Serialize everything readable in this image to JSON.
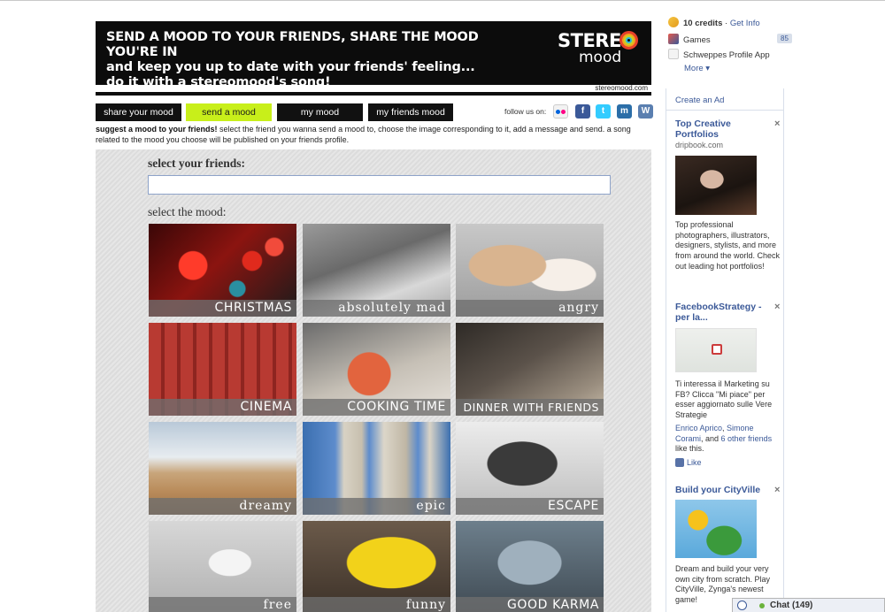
{
  "banner": {
    "line1": "SEND A MOOD TO YOUR FRIENDS, SHARE THE MOOD YOU'RE IN",
    "line2": "and keep you up to date with your friends' feeling...",
    "line3": "do it with a stereomood's song!",
    "logo_top": "STERE",
    "logo_bottom": "mood",
    "url": "stereomood.com"
  },
  "tabs": [
    "share your mood",
    "send a mood",
    "my mood",
    "my friends mood"
  ],
  "active_tab": "send a mood",
  "follow_label": "follow us on:",
  "social_icons": [
    "flickr-icon",
    "facebook-icon",
    "twitter-icon",
    "myspace-icon",
    "wordpress-icon"
  ],
  "intro": {
    "bold": "suggest a mood to your friends!",
    "text": " select the friend you wanna send a mood to, choose the image corresponding to it, add a message and send. a song related to the mood you choose will be published on your friends profile."
  },
  "select_friends_label": "select your friends:",
  "friends_input_value": "",
  "select_mood_label": "select the mood:",
  "moods": [
    "CHRISTMAS",
    "absolutely mad",
    "angry",
    "CINEMA",
    "COOKING TIME",
    "DINNER WITH FRIENDS",
    "dreamy",
    "epic",
    "ESCAPE",
    "free",
    "funny",
    "GOOD KARMA"
  ],
  "fb": {
    "credits": "10 credits",
    "credits_sep": " · ",
    "get_info": "Get Info",
    "games": "Games",
    "games_count": "85",
    "app": "Schweppes Profile App",
    "more": "More ▾",
    "create_ad": "Create an Ad",
    "ads": [
      {
        "title": "Top Creative Portfolios",
        "domain": "dripbook.com",
        "body": "Top professional photographers, illustrators, designers, stylists, and more from around the world. Check out leading hot portfolios!"
      },
      {
        "title": "FacebookStrategy - per la...",
        "body": "Ti interessa il Marketing su FB? Clicca \"Mi piace\" per esser aggiornato sulle Vere Strategie",
        "social_names": "Enrico Aprico",
        "social_sep": ", ",
        "social_name2": "Simone Corami",
        "social_and": ", and ",
        "social_others": "6 other friends",
        "social_tail": " like this.",
        "like": "Like"
      },
      {
        "title": "Build your CityVille",
        "body": "Dream and build your very own city from scratch. Play CityVille, Zynga's newest game!"
      }
    ],
    "close": "×",
    "chat": "Chat (149)"
  }
}
